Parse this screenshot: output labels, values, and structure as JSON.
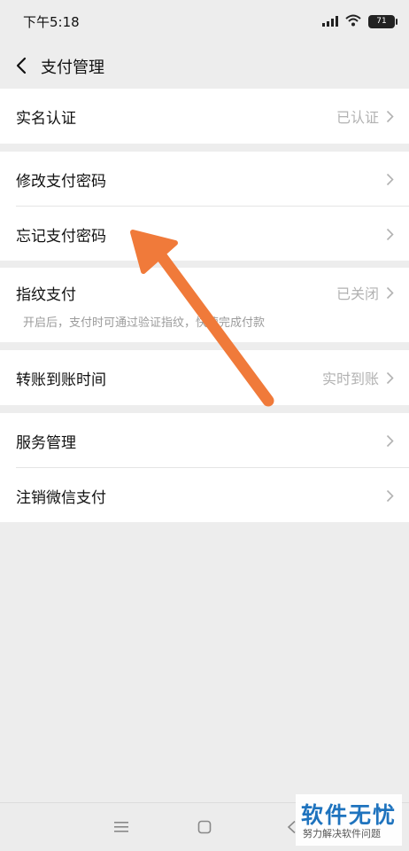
{
  "status_bar": {
    "time": "下午5:18",
    "battery": "71"
  },
  "nav": {
    "title": "支付管理"
  },
  "groups": [
    {
      "items": [
        {
          "label": "实名认证",
          "value": "已认证"
        }
      ]
    },
    {
      "items": [
        {
          "label": "修改支付密码",
          "value": ""
        },
        {
          "label": "忘记支付密码",
          "value": ""
        }
      ]
    },
    {
      "items": [
        {
          "label": "指纹支付",
          "value": "已关闭",
          "sub": "开启后，支付时可通过验证指纹，快速完成付款"
        }
      ]
    },
    {
      "items": [
        {
          "label": "转账到账时间",
          "value": "实时到账"
        }
      ]
    },
    {
      "items": [
        {
          "label": "服务管理",
          "value": ""
        },
        {
          "label": "注销微信支付",
          "value": ""
        }
      ]
    }
  ],
  "watermark": {
    "main": "软件无忧",
    "sub": "努力解决软件问题"
  },
  "colors": {
    "background": "#ededed",
    "arrow": "#f07a3a",
    "secondary_text": "#b2b2b2",
    "watermark_blue": "#1e73be"
  },
  "icons": {
    "back": "chevron-left-icon",
    "chevron": "chevron-right-icon",
    "wifi": "wifi-icon",
    "signal": "signal-icon",
    "battery": "battery-icon"
  }
}
